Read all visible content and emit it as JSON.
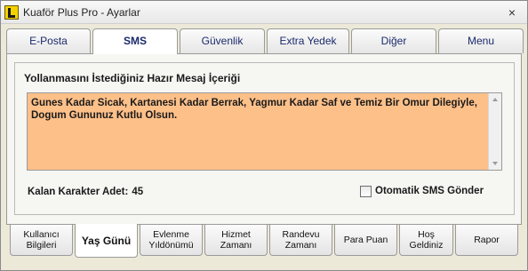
{
  "window": {
    "title": "Kuaför Plus Pro - Ayarlar",
    "close_label": "×"
  },
  "top_tabs": [
    "E-Posta",
    "SMS",
    "Güvenlik",
    "Extra Yedek",
    "Diğer",
    "Menu"
  ],
  "active_top_tab": "SMS",
  "sms": {
    "group_title": "Yollanmasını İstediğiniz Hazır Mesaj İçeriği",
    "message": "Gunes Kadar Sicak, Kartanesi Kadar Berrak, Yagmur Kadar Saf ve Temiz Bir Omur Dilegiyle, Dogum Gununuz Kutlu Olsun.",
    "message_bg_color": "#fdc089",
    "remaining_label": "Kalan Karakter Adet:",
    "remaining_value": "45",
    "auto_send_label": "Otomatik SMS Gönder",
    "auto_send_checked": false
  },
  "bottom_tabs": [
    "Kullanıcı Bilgileri",
    "Yaş Günü",
    "Evlenme Yıldönümü",
    "Hizmet Zamanı",
    "Randevu Zamanı",
    "Para Puan",
    "Hoş Geldiniz",
    "Rapor"
  ],
  "active_bottom_tab": "Yaş Günü"
}
